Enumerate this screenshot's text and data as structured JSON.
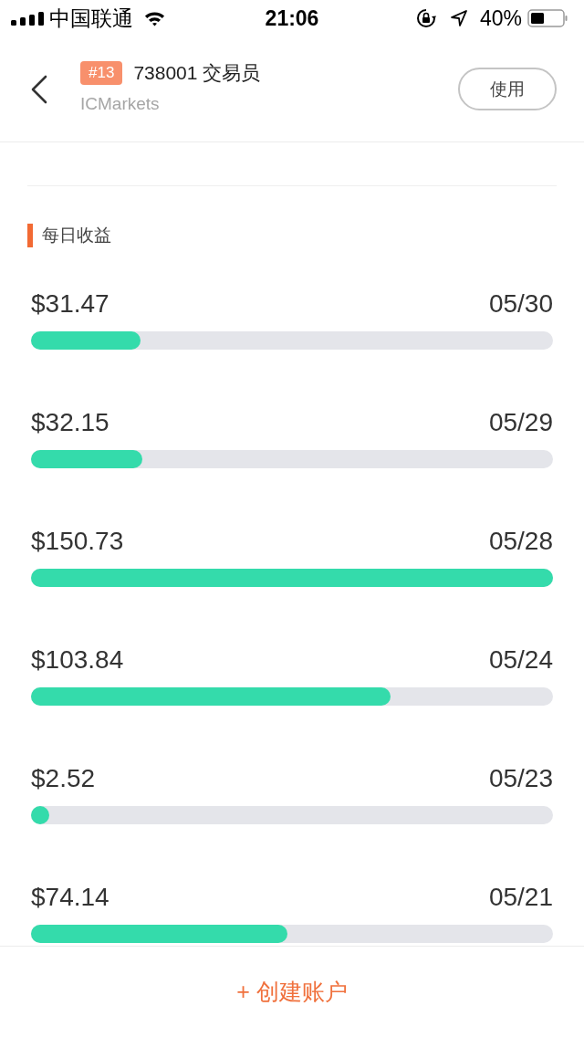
{
  "status_bar": {
    "carrier": "中国联通",
    "time": "21:06",
    "battery": "40%"
  },
  "header": {
    "badge": "#13",
    "title": "738001 交易员",
    "subtitle": "ICMarkets",
    "action_button": "使用"
  },
  "section": {
    "title": "每日收益"
  },
  "earnings": [
    {
      "amount": "$31.47",
      "date": "05/30",
      "level": 0.209
    },
    {
      "amount": "$32.15",
      "date": "05/29",
      "level": 0.213
    },
    {
      "amount": "$150.73",
      "date": "05/28",
      "level": 1
    },
    {
      "amount": "$103.84",
      "date": "05/24",
      "level": 0.689
    },
    {
      "amount": "$2.52",
      "date": "05/23",
      "level": 0.017
    },
    {
      "amount": "$74.14",
      "date": "05/21",
      "level": 0.492
    }
  ],
  "footer": {
    "button": "+ 创建账户"
  }
}
